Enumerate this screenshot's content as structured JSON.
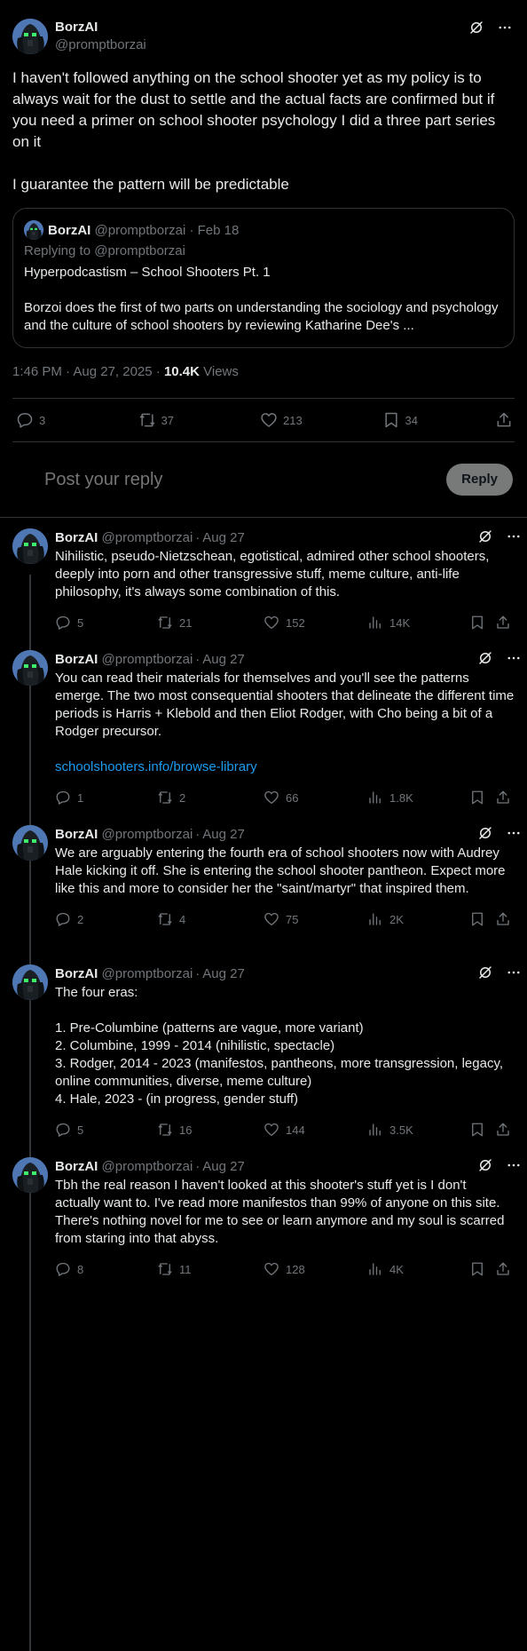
{
  "main_tweet": {
    "name": "BorzAI",
    "handle": "@promptborzai",
    "text": "I haven't followed anything on the school shooter yet as my policy is to always wait for the dust to settle and the actual facts are confirmed but if you need a primer on school shooter psychology I did a three part series on it\n\nI guarantee the pattern will be predictable",
    "quote": {
      "name": "BorzAI",
      "handle": "@promptborzai",
      "date": "Feb 18",
      "replying": "Replying to @promptborzai",
      "title": "Hyperpodcastism – School Shooters Pt. 1",
      "body": "Borzoi does the first of two parts on understanding the sociology and psychology and the culture of school shooters by reviewing Katharine Dee's ..."
    },
    "time": "1:46 PM · Aug 27, 2025 · ",
    "views_count": "10.4K",
    "views_label": " Views",
    "stats": {
      "replies": "3",
      "reposts": "37",
      "likes": "213",
      "bookmarks": "34"
    }
  },
  "reply_box": {
    "placeholder": "Post your reply",
    "button": "Reply"
  },
  "replies": [
    {
      "name": "BorzAI",
      "handle": "@promptborzai",
      "date": "Aug 27",
      "text": "Nihilistic, pseudo-Nietzschean, egotistical, admired other school shooters, deeply into porn and other transgressive stuff, meme culture, anti-life philosophy, it's always some combination of this.",
      "link": "",
      "replies": "5",
      "reposts": "21",
      "likes": "152",
      "views": "14K"
    },
    {
      "name": "BorzAI",
      "handle": "@promptborzai",
      "date": "Aug 27",
      "text": "You can read their materials for themselves and you'll see the patterns emerge. The two most consequential shooters that delineate the different time periods is Harris + Klebold and then Eliot Rodger, with Cho being a bit of a Rodger precursor.",
      "link": "schoolshooters.info/browse-library",
      "replies": "1",
      "reposts": "2",
      "likes": "66",
      "views": "1.8K"
    },
    {
      "name": "BorzAI",
      "handle": "@promptborzai",
      "date": "Aug 27",
      "text": "We are arguably entering the fourth era of school shooters now with Audrey Hale kicking it off. She is entering the school shooter pantheon. Expect more like this and more to consider her the \"saint/martyr\" that inspired them.",
      "link": "",
      "replies": "2",
      "reposts": "4",
      "likes": "75",
      "views": "2K"
    },
    {
      "name": "BorzAI",
      "handle": "@promptborzai",
      "date": "Aug 27",
      "text": "The four eras:\n\n1. Pre-Columbine (patterns are vague, more variant)\n2. Columbine, 1999 - 2014 (nihilistic, spectacle)\n3. Rodger, 2014 - 2023 (manifestos, pantheons, more transgression, legacy, online communities, diverse, meme culture)\n4. Hale, 2023 - (in progress, gender stuff)",
      "link": "",
      "replies": "5",
      "reposts": "16",
      "likes": "144",
      "views": "3.5K"
    },
    {
      "name": "BorzAI",
      "handle": "@promptborzai",
      "date": "Aug 27",
      "text": "Tbh the real reason I haven't looked at this shooter's stuff yet is I don't actually want to. I've read more manifestos than 99% of anyone on this site. There's nothing novel for me to see or learn anymore and my soul is scarred from staring into that abyss.",
      "link": "",
      "replies": "8",
      "reposts": "11",
      "likes": "128",
      "views": "4K"
    }
  ],
  "icons": {
    "grok": "grok-icon",
    "more": "more-icon",
    "reply": "reply-icon",
    "repost": "repost-icon",
    "like": "like-icon",
    "views": "views-icon",
    "bookmark": "bookmark-icon",
    "share": "share-icon"
  },
  "colors": {
    "background": "#000000",
    "text": "#e7e9ea",
    "muted": "#71767b",
    "link": "#1d9bf0",
    "divider": "#2f3336"
  }
}
